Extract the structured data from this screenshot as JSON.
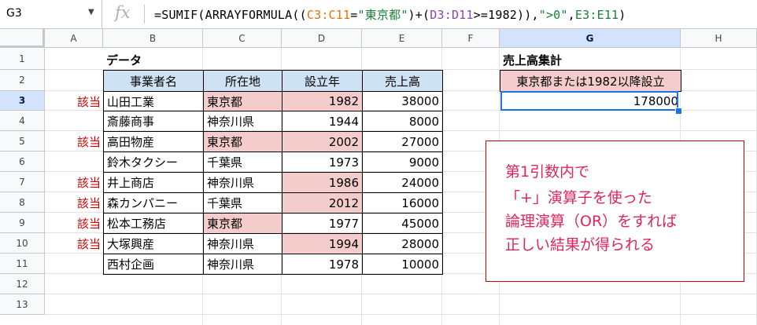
{
  "formula_bar": {
    "cell_ref": "G3",
    "fx_label": "fx",
    "formula_parts": [
      {
        "text": "=SUMIF(ARRAYFORMULA((",
        "cls": ""
      },
      {
        "text": "C3:C11",
        "cls": "ref-orange"
      },
      {
        "text": "=",
        "cls": ""
      },
      {
        "text": "\"東京都\"",
        "cls": "str-green"
      },
      {
        "text": ")+(",
        "cls": ""
      },
      {
        "text": "D3:D11",
        "cls": "ref-purple"
      },
      {
        "text": ">=1982)),",
        "cls": ""
      },
      {
        "text": "\">0\"",
        "cls": "str-green"
      },
      {
        "text": ",",
        "cls": ""
      },
      {
        "text": "E3:E11",
        "cls": "ref-green"
      },
      {
        "text": ")",
        "cls": ""
      }
    ]
  },
  "columns": [
    "A",
    "B",
    "C",
    "D",
    "E",
    "F",
    "G",
    "H"
  ],
  "rows": [
    "1",
    "2",
    "3",
    "4",
    "5",
    "6",
    "7",
    "8",
    "9",
    "10",
    "11",
    "12",
    "13"
  ],
  "active_column": "G",
  "active_row": "3",
  "section_title": "データ",
  "table_headers": [
    "事業者名",
    "所在地",
    "設立年",
    "売上高"
  ],
  "table_rows": [
    {
      "flag": "該当",
      "name": "山田工業",
      "location": "東京都",
      "year": "1982",
      "sales": "38000",
      "loc_hl": true,
      "year_hl": true
    },
    {
      "flag": "",
      "name": "斎藤商事",
      "location": "神奈川県",
      "year": "1944",
      "sales": "8000",
      "loc_hl": false,
      "year_hl": false
    },
    {
      "flag": "該当",
      "name": "高田物産",
      "location": "東京都",
      "year": "2002",
      "sales": "27000",
      "loc_hl": true,
      "year_hl": true
    },
    {
      "flag": "",
      "name": "鈴木タクシー",
      "location": "千葉県",
      "year": "1973",
      "sales": "9000",
      "loc_hl": false,
      "year_hl": false
    },
    {
      "flag": "該当",
      "name": "井上商店",
      "location": "神奈川県",
      "year": "1986",
      "sales": "24000",
      "loc_hl": false,
      "year_hl": true
    },
    {
      "flag": "該当",
      "name": "森カンパニー",
      "location": "千葉県",
      "year": "2012",
      "sales": "16000",
      "loc_hl": false,
      "year_hl": true
    },
    {
      "flag": "該当",
      "name": "松本工務店",
      "location": "東京都",
      "year": "1977",
      "sales": "45000",
      "loc_hl": true,
      "year_hl": false
    },
    {
      "flag": "該当",
      "name": "大塚興産",
      "location": "神奈川県",
      "year": "1994",
      "sales": "28000",
      "loc_hl": false,
      "year_hl": true
    },
    {
      "flag": "",
      "name": "西村企画",
      "location": "神奈川県",
      "year": "1978",
      "sales": "10000",
      "loc_hl": false,
      "year_hl": false
    }
  ],
  "summary_title": "売上高集計",
  "summary_header": "東京都または1982以降設立",
  "summary_value": "178000",
  "note_lines": [
    "第1引数内で",
    "「+」演算子を使った",
    "論理演算（OR）をすれば",
    "正しい結果が得られる"
  ],
  "colors": {
    "header_fill": "#cfe2f3",
    "highlight_fill": "#f4cccc",
    "flag_text": "#cc0000",
    "note_text": "#e0245e",
    "selection": "#1a73e8"
  }
}
